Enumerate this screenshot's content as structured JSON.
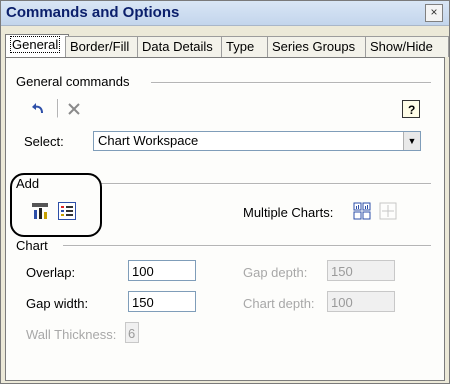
{
  "window": {
    "title": "Commands and Options",
    "close_glyph": "×"
  },
  "tabs": [
    {
      "label": "General",
      "active": true
    },
    {
      "label": "Border/Fill"
    },
    {
      "label": "Data Details"
    },
    {
      "label": "Type"
    },
    {
      "label": "Series Groups"
    },
    {
      "label": "Show/Hide"
    }
  ],
  "general_commands": {
    "title": "General commands",
    "undo_icon": "undo-icon",
    "delete_icon": "delete-icon",
    "help_icon": "help-icon",
    "select_label": "Select:",
    "select_value": "Chart Workspace"
  },
  "add": {
    "title": "Add",
    "add_chart_icon": "add-chart-icon",
    "add_legend_icon": "add-legend-icon",
    "multiple_charts_label": "Multiple Charts:"
  },
  "chart": {
    "title": "Chart",
    "overlap_label": "Overlap:",
    "overlap_value": "100",
    "gap_width_label": "Gap width:",
    "gap_width_value": "150",
    "wall_thickness_label": "Wall Thickness:",
    "wall_thickness_value": "6",
    "gap_depth_label": "Gap depth:",
    "gap_depth_value": "150",
    "chart_depth_label": "Chart depth:",
    "chart_depth_value": "100"
  },
  "colors": {
    "title_text": "#0b1f6b",
    "disabled_text": "#a8a8a8"
  }
}
